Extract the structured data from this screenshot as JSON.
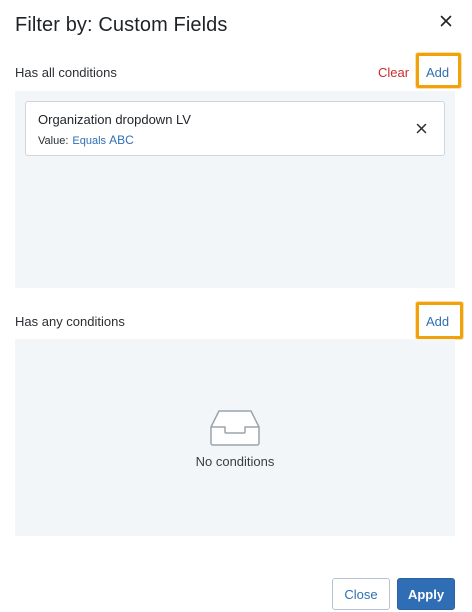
{
  "dialog": {
    "title": "Filter by: Custom Fields"
  },
  "all_conditions": {
    "label": "Has all conditions",
    "clear_label": "Clear",
    "add_label": "Add",
    "items": [
      {
        "title": "Organization dropdown LV",
        "value_label": "Value:",
        "operator": "Equals",
        "value": "ABC"
      }
    ]
  },
  "any_conditions": {
    "label": "Has any conditions",
    "add_label": "Add",
    "empty_text": "No conditions"
  },
  "footer": {
    "close_label": "Close",
    "apply_label": "Apply"
  },
  "colors": {
    "accent": "#2f6fb5",
    "danger": "#cc2b2b",
    "highlight": "#f1a20b",
    "panel_bg": "#f3f6f9"
  },
  "icons": {
    "close": "close-icon",
    "remove_condition": "close-icon",
    "empty": "inbox-tray-icon"
  }
}
